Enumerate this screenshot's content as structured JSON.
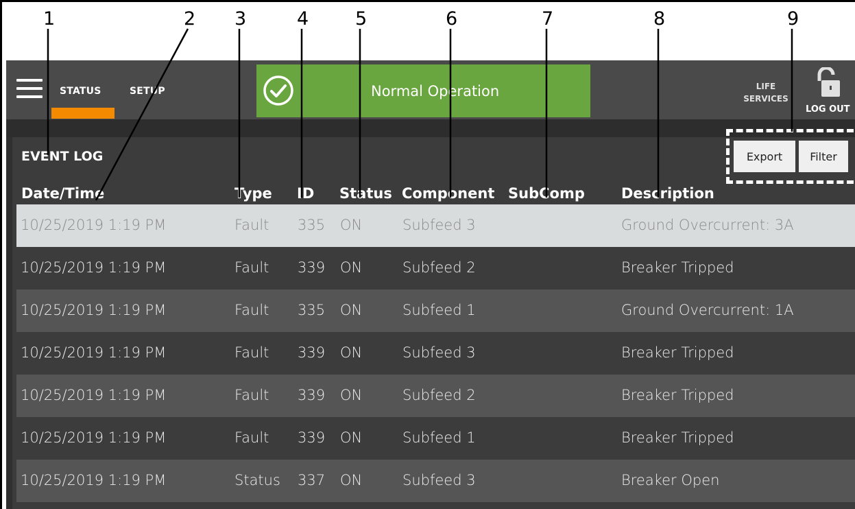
{
  "callouts": [
    "1",
    "2",
    "3",
    "4",
    "5",
    "6",
    "7",
    "8",
    "9"
  ],
  "nav": {
    "tabs": [
      {
        "label": "STATUS",
        "active": true
      },
      {
        "label": "SETUP",
        "active": false
      }
    ],
    "accent_color": "#f38a00"
  },
  "status_banner": {
    "text": "Normal Operation",
    "icon": "check-circle-icon",
    "color": "#6aa63f"
  },
  "header_right": {
    "life_services_line1": "LIFE",
    "life_services_line2": "SERVICES",
    "logout_label": "LOG OUT",
    "lock_icon": "unlocked-padlock-icon"
  },
  "event_log": {
    "title": "EVENT LOG",
    "export_label": "Export",
    "filter_label": "Filter",
    "columns": {
      "datetime": "Date/Time",
      "type": "Type",
      "id": "ID",
      "status": "Status",
      "component": "Component",
      "subcomp": "SubComp",
      "description": "Description"
    },
    "rows": [
      {
        "datetime": "10/25/2019 1:19 PM",
        "type": "Fault",
        "id": "335",
        "status": "ON",
        "component": "Subfeed 3",
        "subcomp": "",
        "description": "Ground Overcurrent: 3A"
      },
      {
        "datetime": "10/25/2019 1:19 PM",
        "type": "Fault",
        "id": "339",
        "status": "ON",
        "component": "Subfeed 2",
        "subcomp": "",
        "description": "Breaker Tripped"
      },
      {
        "datetime": "10/25/2019 1:19 PM",
        "type": "Fault",
        "id": "335",
        "status": "ON",
        "component": "Subfeed 1",
        "subcomp": "",
        "description": "Ground Overcurrent: 1A"
      },
      {
        "datetime": "10/25/2019 1:19 PM",
        "type": "Fault",
        "id": "339",
        "status": "ON",
        "component": "Subfeed 3",
        "subcomp": "",
        "description": "Breaker Tripped"
      },
      {
        "datetime": "10/25/2019 1:19 PM",
        "type": "Fault",
        "id": "339",
        "status": "ON",
        "component": "Subfeed 2",
        "subcomp": "",
        "description": "Breaker Tripped"
      },
      {
        "datetime": "10/25/2019 1:19 PM",
        "type": "Fault",
        "id": "339",
        "status": "ON",
        "component": "Subfeed 1",
        "subcomp": "",
        "description": "Breaker Tripped"
      },
      {
        "datetime": "10/25/2019 1:19 PM",
        "type": "Status",
        "id": "337",
        "status": "ON",
        "component": "Subfeed 3",
        "subcomp": "",
        "description": "Breaker Open"
      }
    ]
  }
}
